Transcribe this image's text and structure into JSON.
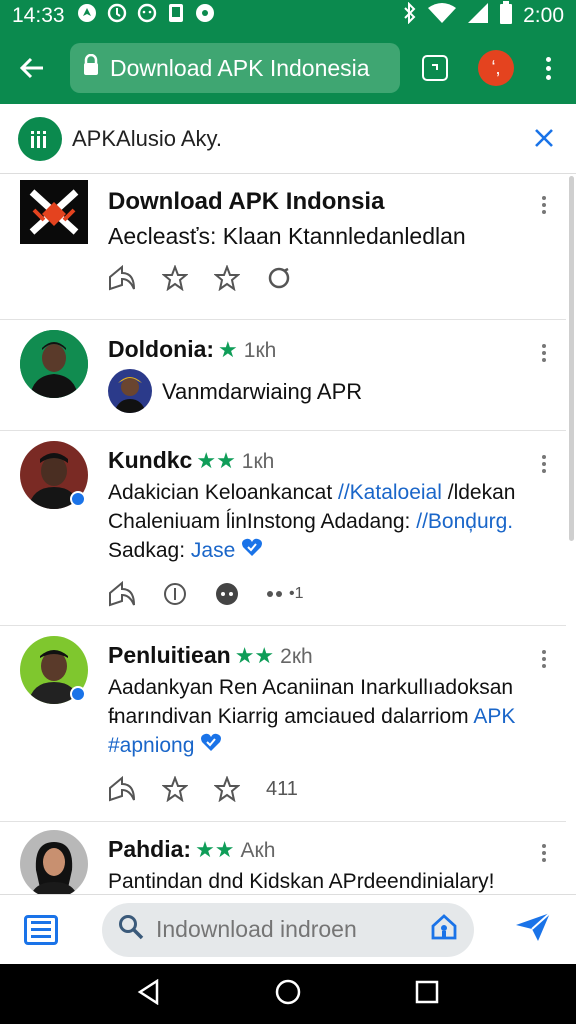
{
  "status_bar": {
    "time": "14:33",
    "clock": "2:00",
    "icons": [
      "navigation-icon",
      "sync-icon",
      "face-icon",
      "phone-icon",
      "dot-icon",
      "bluetooth-icon",
      "wifi-icon",
      "signal-icon",
      "battery-icon"
    ]
  },
  "app_bar": {
    "url": "Download APK Indonesia",
    "avatar_glyph": "ʻ,",
    "colors": {
      "primary": "#0b8a4e",
      "url_box": "#3fa672",
      "avatar": "#e4431f"
    }
  },
  "banner": {
    "title": "APKAlusio Aky."
  },
  "posts": [
    {
      "name": "Download APK Indonsia",
      "body": "Aecleasťs: Klaan Ktannledanledlan",
      "actions": [
        "share-icon",
        "star-icon",
        "star-icon",
        "refresh-icon"
      ]
    },
    {
      "name": "Doldonia:",
      "stars": "★",
      "meta": "1кh",
      "sub_text": "Vanmdarwiaing APR"
    },
    {
      "name": "Kundkc",
      "stars": "★★",
      "meta": "1кh",
      "line1": "Adakician Keloankancat ",
      "link1": "//Kataloeial",
      "line1b": " /ldekan",
      "line2": "Chaleniuam ĺinInstong Adadang: ",
      "link2": "//Bonḑurg.",
      "line3": "Sadkag: ",
      "link3": "Jase",
      "action_count": "•1"
    },
    {
      "name": "Penluitiean",
      "stars": "★★",
      "meta": "2кh",
      "line1": "Aadankyan Ren Acaniinan Inarkullıadoksan",
      "line2": "f̵narındivan Kiarrig amciaued dalarriom ",
      "link2": "APK",
      "link3": "#apniong",
      "action_count": "411"
    },
    {
      "name": "Pahdia:",
      "stars": "★★",
      "meta": "Aкh",
      "line1": "Pantindan dnd Kidskan APrdeendinialary!"
    }
  ],
  "search": {
    "placeholder": "Indownload indroen"
  }
}
